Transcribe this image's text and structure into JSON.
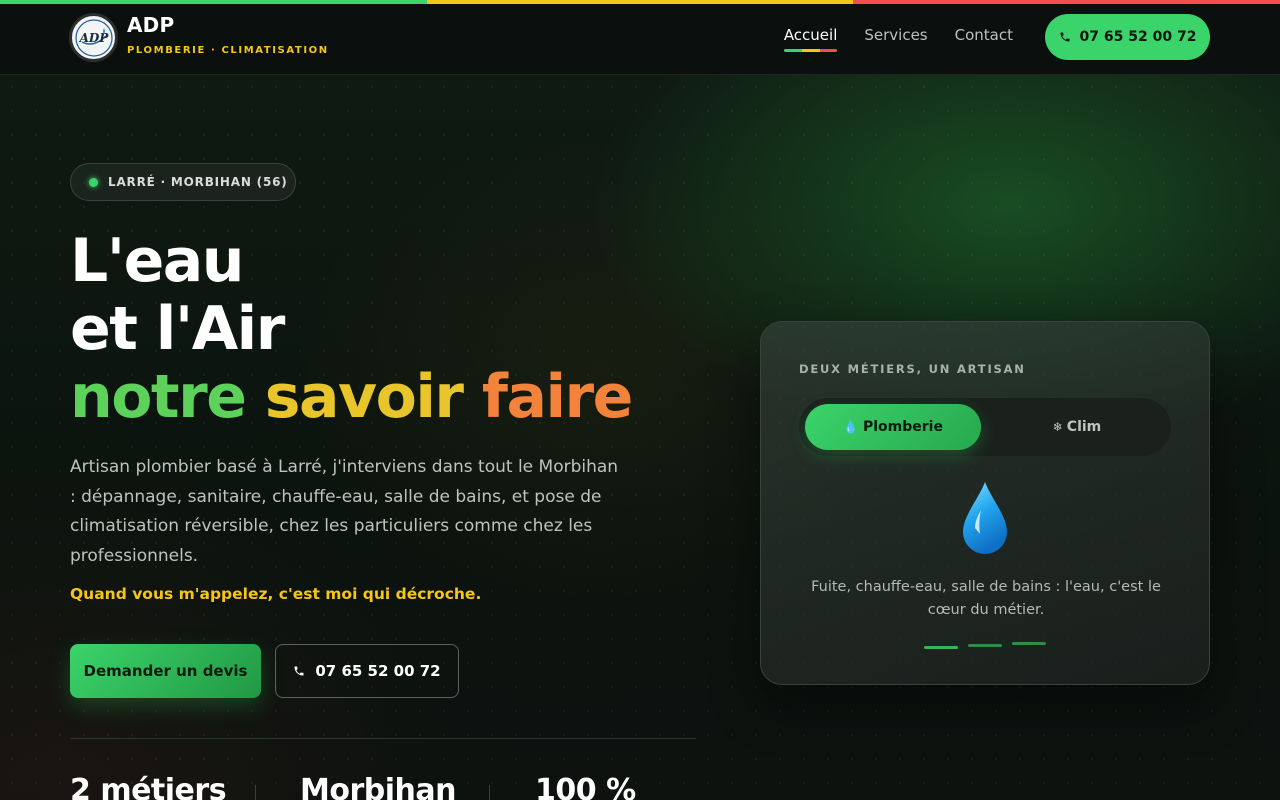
{
  "colors": {
    "green": "#3bd46a",
    "yellow": "#f5c518",
    "red": "#ef4f4f",
    "background": "#0b100d"
  },
  "header": {
    "brand": "ADP",
    "logo_text": "ADP",
    "tagline": "PLOMBERIE · CLIMATISATION",
    "nav": [
      {
        "label": "Accueil",
        "active": true
      },
      {
        "label": "Services",
        "active": false
      },
      {
        "label": "Contact",
        "active": false
      }
    ],
    "phone": "07 65 52 00 72"
  },
  "hero": {
    "location": "LARRÉ · MORBIHAN (56)",
    "title_line1": "L'eau",
    "title_line2": "et l'Air",
    "title_word1": "notre",
    "title_word2": "savoir",
    "title_word3": "faire",
    "intro": "Artisan plombier basé à Larré, j'interviens dans tout le Morbihan : dépannage, sanitaire, chauffe-eau, salle de bains, et pose de climatisation réversible, chez les particuliers comme chez les professionnels.",
    "tagline": "Quand vous m'appelez, c'est moi qui décroche.",
    "cta_quote": "Demander un devis",
    "cta_phone": "07 65 52 00 72"
  },
  "stats": [
    "2 métiers",
    "Morbihan",
    "100 %"
  ],
  "card": {
    "label": "DEUX MÉTIERS, UN ARTISAN",
    "tabs": [
      {
        "icon": "💧",
        "label": "Plomberie",
        "active": true
      },
      {
        "icon": "❄",
        "label": "Clim",
        "active": false
      }
    ],
    "illustration": "water-drop-icon",
    "description": "Fuite, chauffe-eau, salle de bains : l'eau, c'est le cœur du métier.",
    "slides": 3,
    "active_slide": 1
  }
}
